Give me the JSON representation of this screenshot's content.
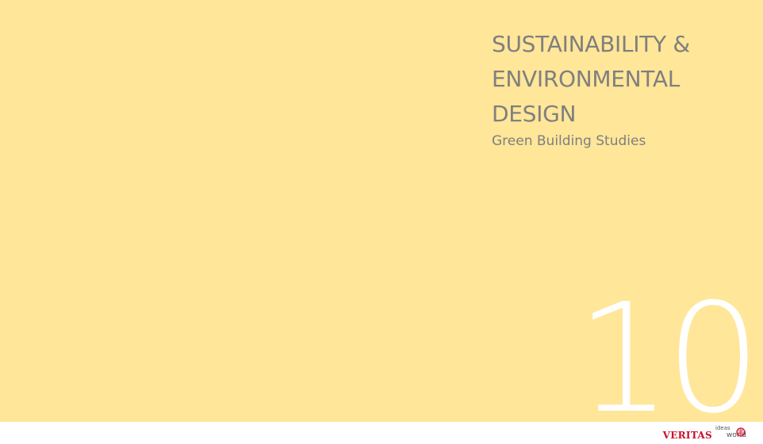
{
  "slide": {
    "title_lines": [
      "SUSTAINABILITY &",
      "ENVIRONMENTAL",
      "DESIGN"
    ],
    "subtitle": "Green Building Studies",
    "section_number": "10"
  },
  "logo": {
    "brand": "VERITAS",
    "tagline_top": "ideas",
    "tagline_bottom": "world",
    "globe_icon": "globe-icon"
  },
  "colors": {
    "panel": "#ffe699",
    "title_text": "#7f7f7f",
    "number_text": "#ffffff",
    "brand": "#c8102e"
  }
}
